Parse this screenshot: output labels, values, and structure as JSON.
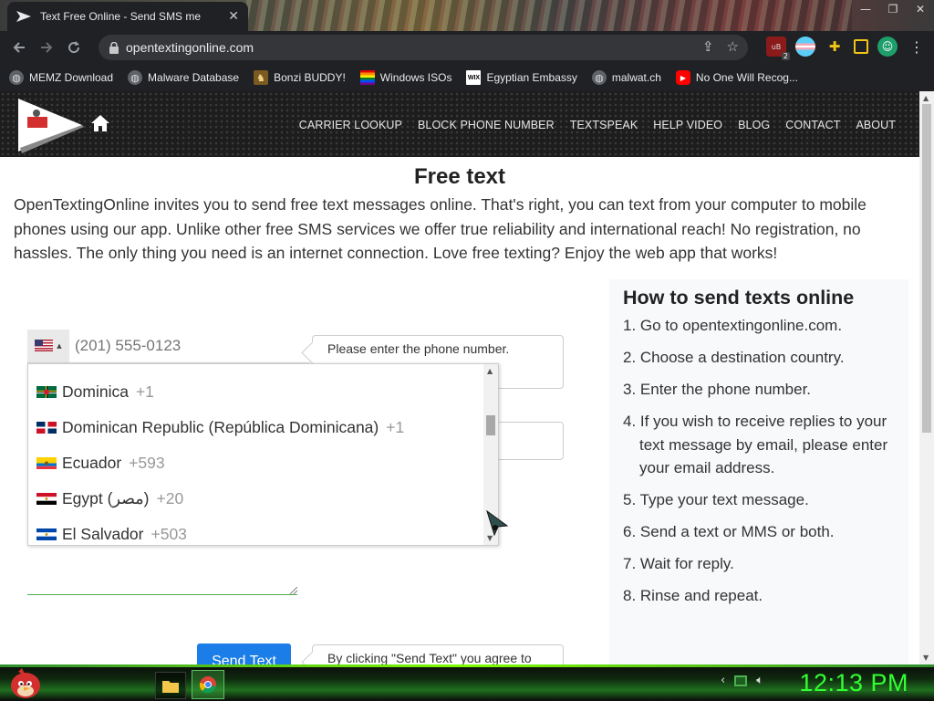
{
  "browser": {
    "tab_title": "Text Free Online - Send SMS me",
    "tab_close": "✕",
    "url": "opentextingonline.com",
    "window_controls": [
      "—",
      "❐",
      "✕"
    ]
  },
  "bookmarks": [
    {
      "label": "MEMZ Download",
      "icon": "globe-icon"
    },
    {
      "label": "Malware Database",
      "icon": "globe-icon"
    },
    {
      "label": "Bonzi BUDDY!",
      "icon": "bonzi-icon"
    },
    {
      "label": "Windows ISOs",
      "icon": "rainbow-flag-icon"
    },
    {
      "label": "Egyptian Embassy",
      "icon": "wix-icon"
    },
    {
      "label": "malwat.ch",
      "icon": "globe-icon"
    },
    {
      "label": "No One Will Recog...",
      "icon": "youtube-icon"
    }
  ],
  "extensions": {
    "badge": "2"
  },
  "site": {
    "nav": [
      "CARRIER LOOKUP",
      "BLOCK PHONE NUMBER",
      "TEXTSPEAK",
      "HELP VIDEO",
      "BLOG",
      "CONTACT",
      "ABOUT"
    ],
    "title": "Free text",
    "intro": "OpenTextingOnline invites you to send free text messages online. That's right, you can text from your computer to mobile phones using our app. Unlike other free SMS services we offer true reliability and international reach! No registration, no hassles. The only thing you need is an internet connection. Love free texting? Enjoy the web app that works!"
  },
  "form": {
    "phone_placeholder": "(201) 555-0123",
    "phone_tip": "Please enter the phone number.",
    "send_label": "Send Text",
    "terms_tip": "By clicking \"Send Text\" you agree to",
    "countries": [
      {
        "name": "Dominica",
        "dial": "+1",
        "flag": "dominica-flag-icon"
      },
      {
        "name": "Dominican Republic (República Dominicana)",
        "dial": "+1",
        "flag": "dominican-republic-flag-icon"
      },
      {
        "name": "Ecuador",
        "dial": "+593",
        "flag": "ecuador-flag-icon"
      },
      {
        "name": "Egypt (‫مصر‬‎)",
        "dial": "+20",
        "flag": "egypt-flag-icon"
      },
      {
        "name": "El Salvador",
        "dial": "+503",
        "flag": "el-salvador-flag-icon"
      }
    ]
  },
  "howto": {
    "title": "How to send texts online",
    "steps": [
      "1. Go to opentextingonline.com.",
      "2. Choose a destination country.",
      "3. Enter the phone number.",
      "4. If you wish to receive replies to your text message by email, please enter your email address.",
      "5. Type your text message.",
      "6. Send a text or MMS or both.",
      "7. Wait for reply.",
      "8. Rinse and repeat."
    ]
  },
  "taskbar": {
    "clock": "12:13 PM"
  },
  "colors": {
    "accent_blue": "#1a7de8",
    "message_underline": "#4caf50",
    "clock_green": "#32ff32",
    "browser_dark": "#202124"
  }
}
